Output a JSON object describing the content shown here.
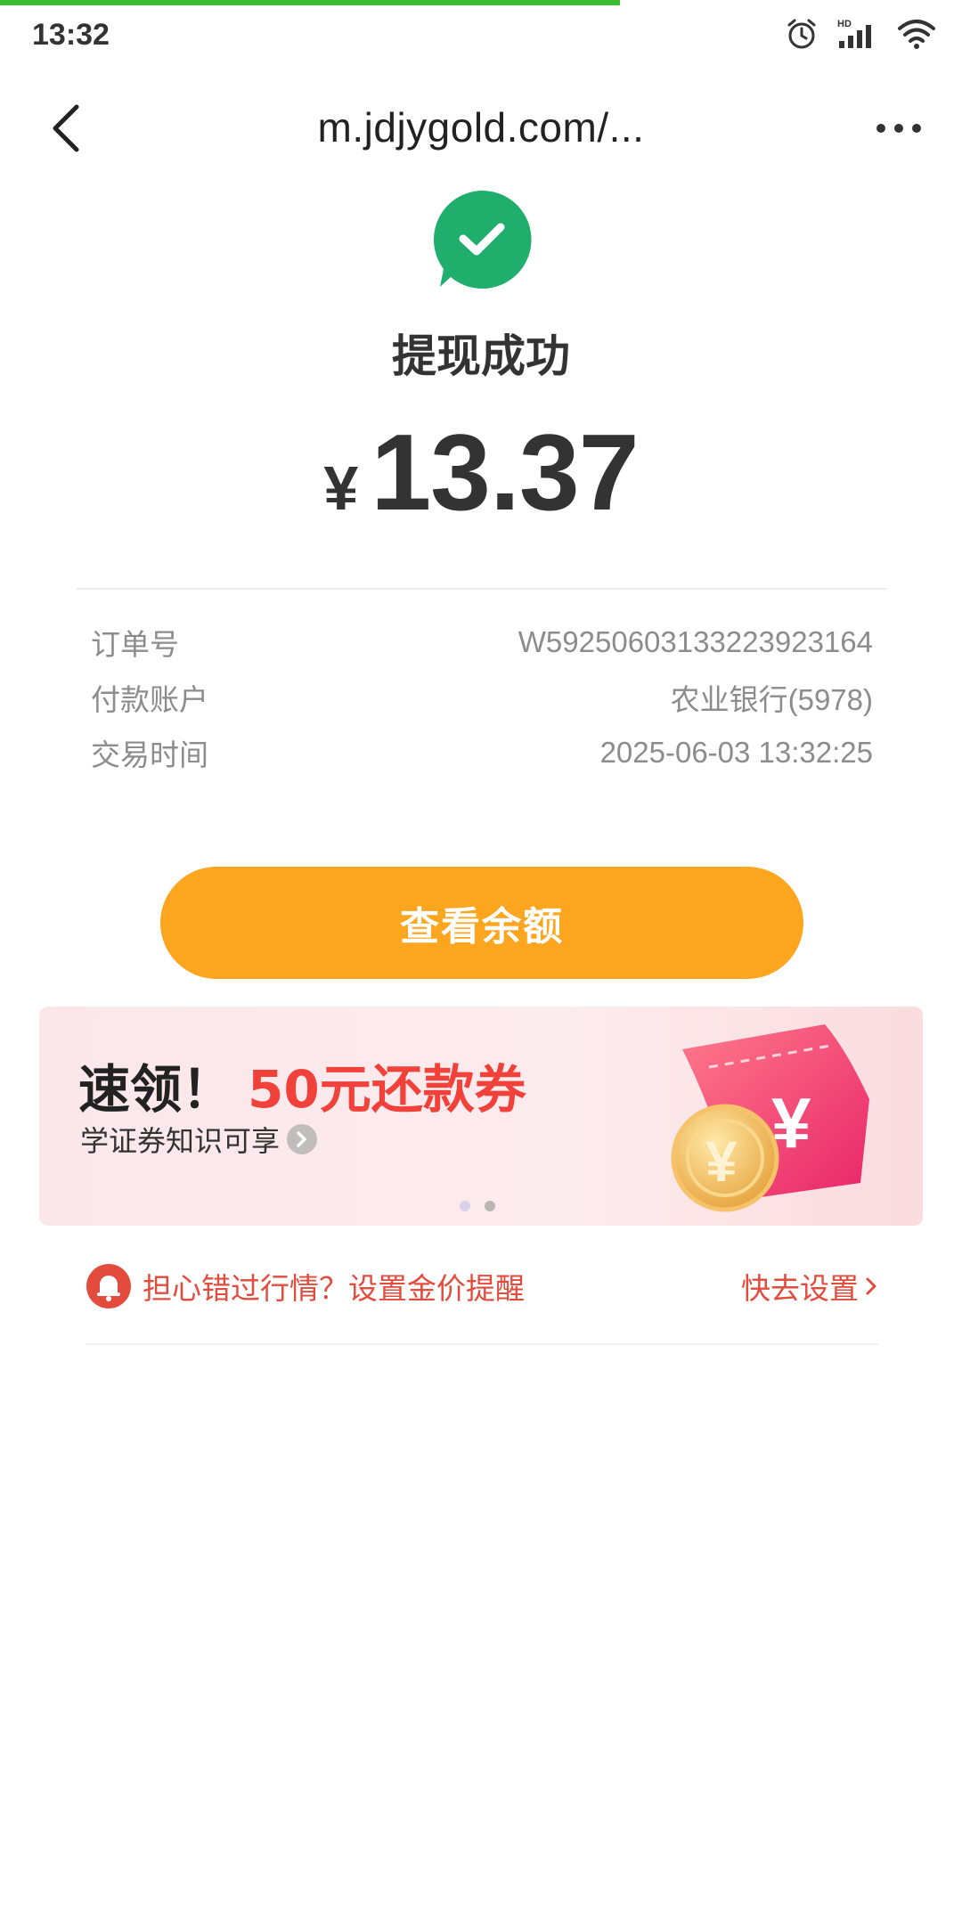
{
  "status_bar": {
    "time": "13:32",
    "icons": [
      "alarm-icon",
      "hd-signal-icon",
      "wifi-icon"
    ]
  },
  "nav": {
    "title": "m.jdjygold.com/...",
    "back_icon": "chevron-left-icon",
    "more_icon": "more-dots-icon"
  },
  "result": {
    "icon": "check-bubble-icon",
    "title": "提现成功",
    "currency": "¥",
    "amount": "13.37"
  },
  "details": [
    {
      "label": "订单号",
      "value": "W5925060313322392316‌4"
    },
    {
      "label": "付款账户",
      "value": "农业银行(5978)"
    },
    {
      "label": "交易时间",
      "value": "2025-06-03 13:32:25"
    }
  ],
  "primary_button": {
    "label": "查看余额"
  },
  "banner": {
    "headline_prefix": "速领！",
    "headline_highlight": "50元还款券",
    "subtitle": "学证券知识可享",
    "dots_count": 2,
    "active_dot": 0
  },
  "reminder": {
    "text": "担心错过行情？设置金价提醒",
    "action": "快去设置",
    "action_icon": "chevron-right-icon"
  },
  "colors": {
    "progress": "#3dbb2f",
    "success_green": "#1fae6b",
    "primary_orange": "#fca61f",
    "banner_red": "#f0413a",
    "reminder_red": "#e34b3d"
  }
}
